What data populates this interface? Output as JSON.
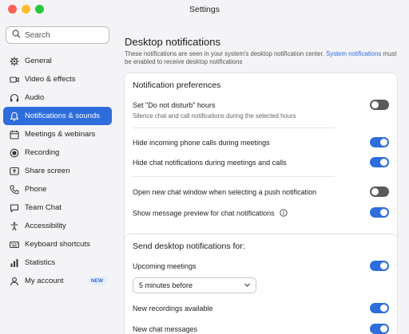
{
  "window": {
    "title": "Settings"
  },
  "colors": {
    "accent": "#2e6ddb",
    "close": "#ff5f57",
    "minimize": "#febc2e",
    "zoom": "#28c840"
  },
  "search": {
    "placeholder": "Search"
  },
  "sidebar": {
    "items": [
      {
        "label": "General",
        "icon": "gear-icon"
      },
      {
        "label": "Video & effects",
        "icon": "video-camera-icon"
      },
      {
        "label": "Audio",
        "icon": "headphones-icon"
      },
      {
        "label": "Notifications & sounds",
        "icon": "bell-icon",
        "active": true
      },
      {
        "label": "Meetings & webinars",
        "icon": "calendar-icon"
      },
      {
        "label": "Recording",
        "icon": "record-icon"
      },
      {
        "label": "Share screen",
        "icon": "share-screen-icon"
      },
      {
        "label": "Phone",
        "icon": "phone-icon"
      },
      {
        "label": "Team Chat",
        "icon": "chat-bubble-icon"
      },
      {
        "label": "Accessibility",
        "icon": "accessibility-icon"
      },
      {
        "label": "Keyboard shortcuts",
        "icon": "keyboard-icon"
      },
      {
        "label": "Statistics",
        "icon": "bar-chart-icon"
      },
      {
        "label": "My account",
        "icon": "person-icon",
        "badge": "NEW"
      }
    ]
  },
  "main": {
    "section_title": "Desktop notifications",
    "desc_part1": "These notifications are seen in your system's desktop notification center.",
    "desc_link": "System notifications",
    "desc_part2": "must be enabled to receive desktop notifications",
    "preferences": {
      "title": "Notification preferences",
      "dnd_label": "Set \"Do not disturb\" hours",
      "dnd_sub": "Silence chat and call notifications during the selected hours",
      "dnd_on": false,
      "hide_calls_label": "Hide incoming phone calls during meetings",
      "hide_calls_on": true,
      "hide_chat_label": "Hide chat notifications during meetings and calls",
      "hide_chat_on": true,
      "open_chat_label": "Open new chat window when selecting a push notification",
      "open_chat_on": false,
      "preview_label": "Show message preview for chat notifications",
      "preview_on": true
    },
    "send": {
      "title": "Send desktop notifications for:",
      "upcoming_label": "Upcoming meetings",
      "upcoming_on": true,
      "upcoming_select": "5 minutes before",
      "recordings_label": "New recordings available",
      "recordings_on": true,
      "chat_label": "New chat messages",
      "chat_on": true
    }
  }
}
